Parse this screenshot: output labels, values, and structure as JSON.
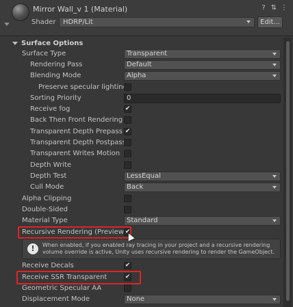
{
  "header": {
    "title": "Mirror Wall_v 1 (Material)",
    "icons": [
      "help-icon",
      "settings-sliders-icon",
      "more-icon"
    ],
    "shader_label": "Shader",
    "shader_value": "HDRP/Lit",
    "edit_label": "Edit..."
  },
  "section": {
    "title": "Surface Options"
  },
  "fields": {
    "surface_type": {
      "label": "Surface Type",
      "value": "Transparent"
    },
    "rendering_pass": {
      "label": "Rendering Pass",
      "value": "Default"
    },
    "blending_mode": {
      "label": "Blending Mode",
      "value": "Alpha"
    },
    "preserve_specular": {
      "label": "Preserve specular lighting",
      "checked": false
    },
    "sorting_priority": {
      "label": "Sorting Priority",
      "value": "0"
    },
    "receive_fog": {
      "label": "Receive fog",
      "checked": true
    },
    "back_then_front": {
      "label": "Back Then Front Rendering",
      "checked": false
    },
    "transparent_depth_prepass": {
      "label": "Transparent Depth Prepass",
      "checked": true
    },
    "transparent_depth_postpass": {
      "label": "Transparent Depth Postpass",
      "checked": false
    },
    "transparent_writes_motion": {
      "label": "Transparent Writes Motion Ve",
      "checked": false
    },
    "depth_write": {
      "label": "Depth Write",
      "checked": false
    },
    "depth_test": {
      "label": "Depth Test",
      "value": "LessEqual"
    },
    "cull_mode": {
      "label": "Cull Mode",
      "value": "Back"
    },
    "alpha_clipping": {
      "label": "Alpha Clipping",
      "checked": false
    },
    "double_sided": {
      "label": "Double-Sided",
      "checked": false
    },
    "material_type": {
      "label": "Material Type",
      "value": "Standard"
    },
    "recursive_rendering": {
      "label": "Recursive Rendering (Preview)",
      "checked": true
    },
    "receive_decals": {
      "label": "Receive Decals",
      "checked": true
    },
    "receive_ssr_transparent": {
      "label": "Receive SSR Transparent",
      "checked": true
    },
    "geometric_specular_aa": {
      "label": "Geometric Specular AA",
      "checked": false
    },
    "displacement_mode": {
      "label": "Displacement Mode",
      "value": "None"
    }
  },
  "help": {
    "icon": "info-icon",
    "text": "When enabled, if you enabled ray tracing in your project and a recursive rendering volume override is active, Unity uses recursive rendering to render the GameObject."
  },
  "colors": {
    "highlight": "#e02424",
    "background": "#383838"
  }
}
